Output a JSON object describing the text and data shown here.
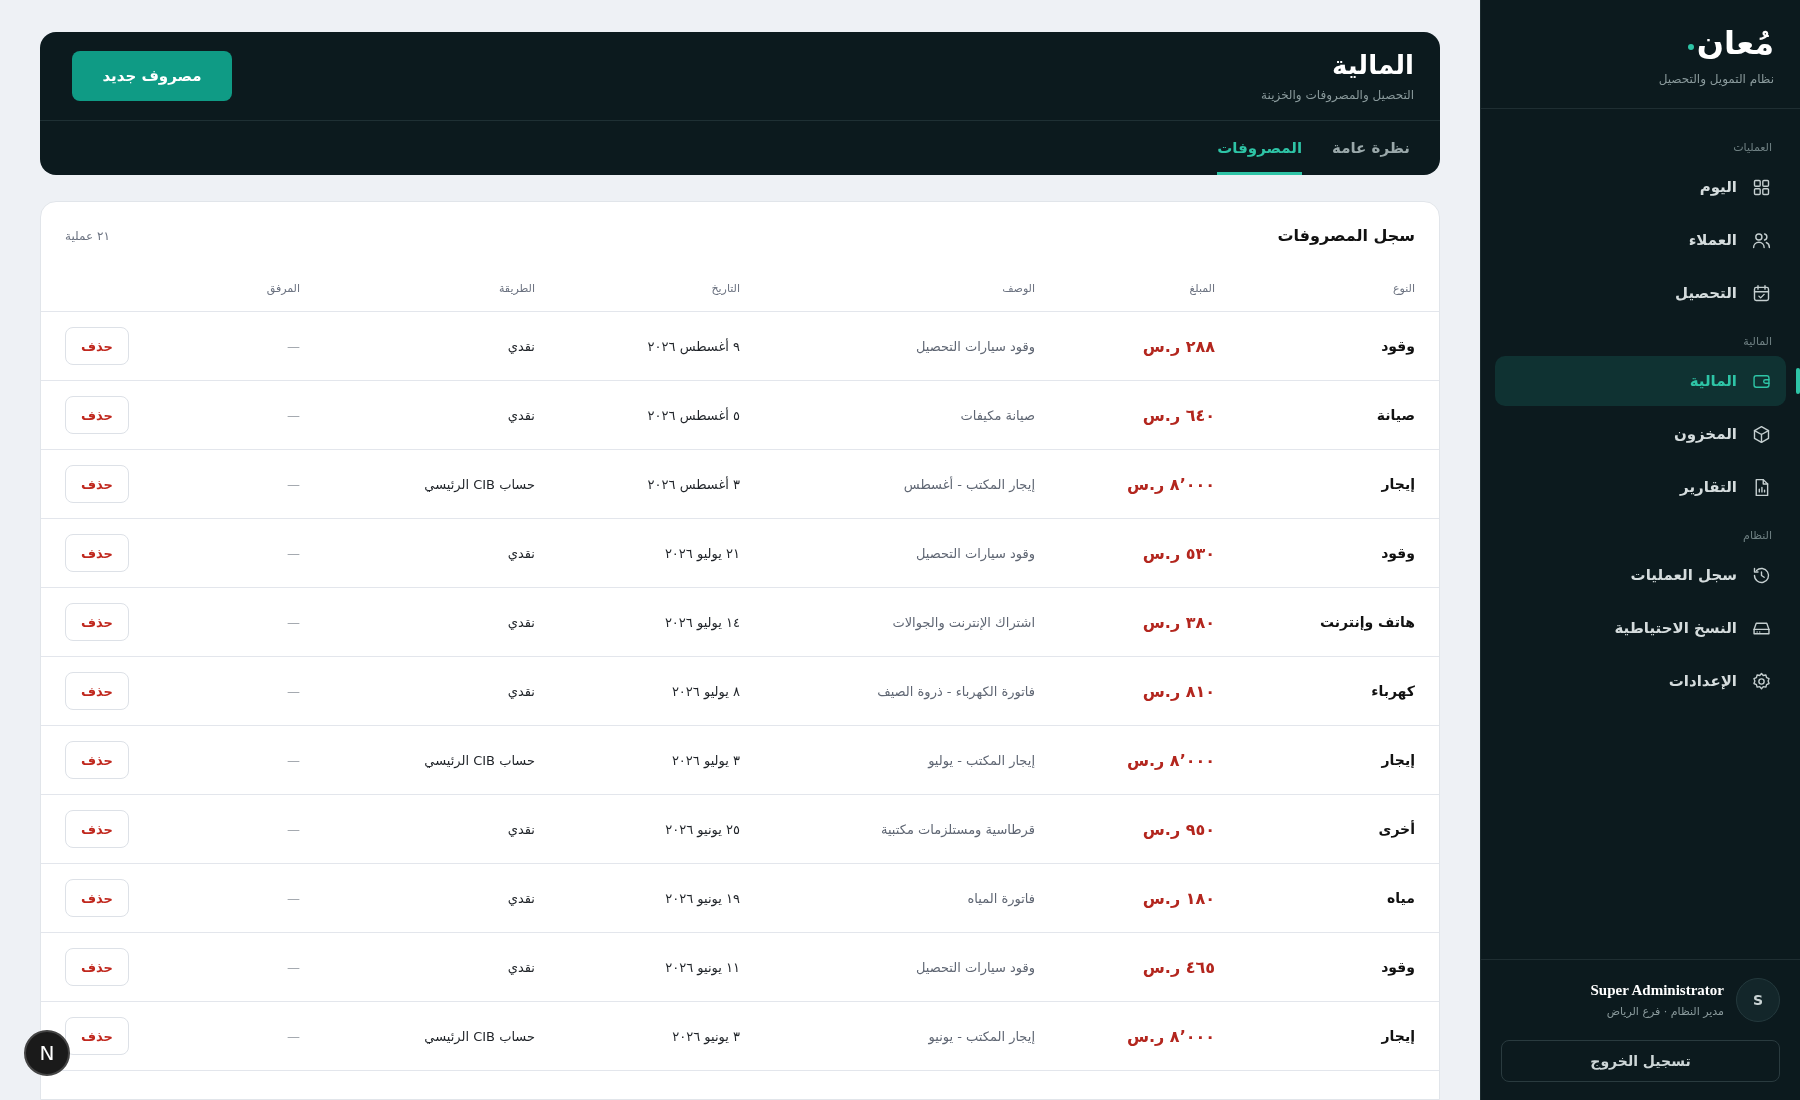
{
  "sidebar": {
    "logo": "مُعان",
    "subtitle": "نظام التمويل والتحصيل",
    "sections": [
      {
        "title": "العمليات",
        "items": [
          {
            "label": "اليوم",
            "selected": false
          },
          {
            "label": "العملاء",
            "selected": false
          },
          {
            "label": "التحصيل",
            "selected": false
          }
        ]
      },
      {
        "title": "المالية",
        "items": [
          {
            "label": "المالية",
            "selected": true
          },
          {
            "label": "المخزون",
            "selected": false
          },
          {
            "label": "التقارير",
            "selected": false
          }
        ]
      },
      {
        "title": "النظام",
        "items": [
          {
            "label": "سجل العمليات",
            "selected": false
          },
          {
            "label": "النسخ الاحتياطية",
            "selected": false
          },
          {
            "label": "الإعدادات",
            "selected": false
          }
        ]
      }
    ],
    "user": {
      "initial": "S",
      "name": "Super Administrator",
      "role": "مدير النظام · فرع الرياض"
    },
    "logout": "تسجيل الخروج"
  },
  "header": {
    "title": "المالية",
    "subtitle": "التحصيل والمصروفات والخزينة",
    "new_button": "مصروف جديد",
    "tabs": [
      {
        "label": "نظرة عامة",
        "selected": false
      },
      {
        "label": "المصروفات",
        "selected": true
      }
    ]
  },
  "table": {
    "title": "سجل المصروفات",
    "count": "٢١ عملية",
    "columns": [
      "النوع",
      "المبلغ",
      "الوصف",
      "التاريخ",
      "الطريقة",
      "المرفق"
    ],
    "rows": [
      {
        "type": "وقود",
        "amount": "٢٨٨ ر.س",
        "description": "وقود سيارات التحصيل",
        "date": "٩ أغسطس ٢٠٢٦",
        "method": "نقدي",
        "attachment": "—",
        "action": "حذف"
      },
      {
        "type": "صيانة",
        "amount": "٦٤٠ ر.س",
        "description": "صيانة مكيفات",
        "date": "٥ أغسطس ٢٠٢٦",
        "method": "نقدي",
        "attachment": "—",
        "action": "حذف"
      },
      {
        "type": "إيجار",
        "amount": "٨٬٠٠٠ ر.س",
        "description": "إيجار المكتب - أغسطس",
        "date": "٣ أغسطس ٢٠٢٦",
        "method": "حساب CIB الرئيسي",
        "attachment": "—",
        "action": "حذف"
      },
      {
        "type": "وقود",
        "amount": "٥٣٠ ر.س",
        "description": "وقود سيارات التحصيل",
        "date": "٢١ يوليو ٢٠٢٦",
        "method": "نقدي",
        "attachment": "—",
        "action": "حذف"
      },
      {
        "type": "هاتف وإنترنت",
        "amount": "٣٨٠ ر.س",
        "description": "اشتراك الإنترنت والجوالات",
        "date": "١٤ يوليو ٢٠٢٦",
        "method": "نقدي",
        "attachment": "—",
        "action": "حذف"
      },
      {
        "type": "كهرباء",
        "amount": "٨١٠ ر.س",
        "description": "فاتورة الكهرباء - ذروة الصيف",
        "date": "٨ يوليو ٢٠٢٦",
        "method": "نقدي",
        "attachment": "—",
        "action": "حذف"
      },
      {
        "type": "إيجار",
        "amount": "٨٬٠٠٠ ر.س",
        "description": "إيجار المكتب - يوليو",
        "date": "٣ يوليو ٢٠٢٦",
        "method": "حساب CIB الرئيسي",
        "attachment": "—",
        "action": "حذف"
      },
      {
        "type": "أخرى",
        "amount": "٩٥٠ ر.س",
        "description": "قرطاسية ومستلزمات مكتبية",
        "date": "٢٥ يونيو ٢٠٢٦",
        "method": "نقدي",
        "attachment": "—",
        "action": "حذف"
      },
      {
        "type": "مياه",
        "amount": "١٨٠ ر.س",
        "description": "فاتورة المياه",
        "date": "١٩ يونيو ٢٠٢٦",
        "method": "نقدي",
        "attachment": "—",
        "action": "حذف"
      },
      {
        "type": "وقود",
        "amount": "٤٦٥ ر.س",
        "description": "وقود سيارات التحصيل",
        "date": "١١ يونيو ٢٠٢٦",
        "method": "نقدي",
        "attachment": "—",
        "action": "حذف"
      },
      {
        "type": "إيجار",
        "amount": "٨٬٠٠٠ ر.س",
        "description": "إيجار المكتب - يونيو",
        "date": "٣ يونيو ٢٠٢٦",
        "method": "حساب CIB الرئيسي",
        "attachment": "—",
        "action": "حذف"
      }
    ]
  },
  "dev_badge": "N"
}
